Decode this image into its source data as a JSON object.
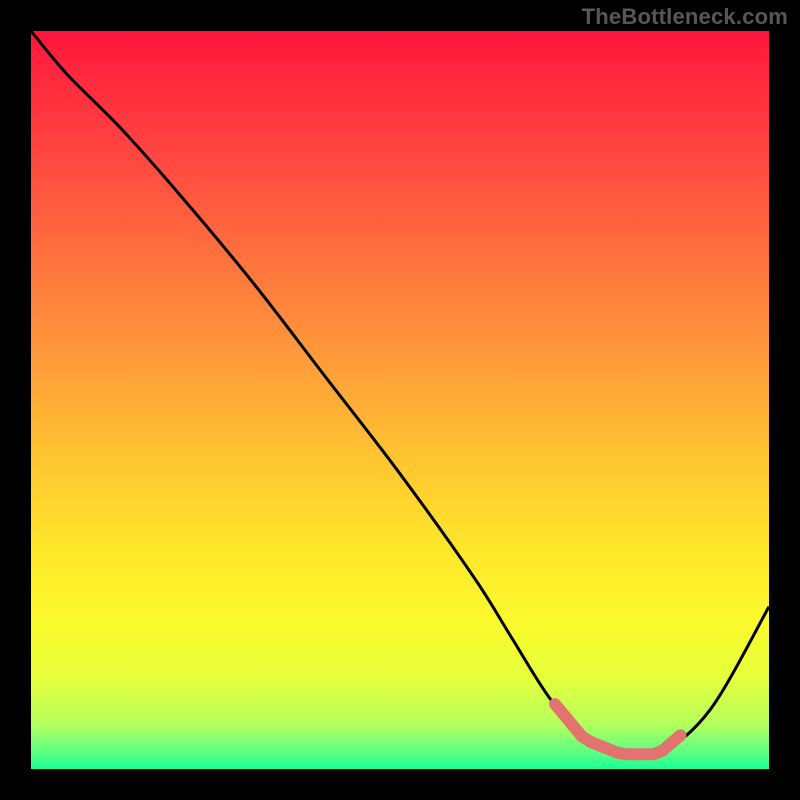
{
  "watermark": "TheBottleneck.com",
  "chart_data": {
    "type": "line",
    "title": "",
    "xlabel": "",
    "ylabel": "",
    "xlim": [
      0,
      100
    ],
    "ylim": [
      0,
      100
    ],
    "series": [
      {
        "name": "bottleneck-curve",
        "x": [
          0,
          5,
          12,
          20,
          30,
          40,
          50,
          60,
          65,
          70,
          75,
          80,
          85,
          92,
          100
        ],
        "values": [
          100,
          94,
          87,
          78,
          66,
          53,
          40,
          26,
          18,
          10,
          4,
          2,
          2,
          8,
          22
        ]
      }
    ],
    "highlight": {
      "name": "optimal-range",
      "x_start": 71,
      "x_end": 88
    },
    "colors": {
      "curve": "#000000",
      "highlight": "#e2736e",
      "background_top": "#ff153d",
      "background_bottom": "#19ff93",
      "frame": "#000000"
    }
  }
}
